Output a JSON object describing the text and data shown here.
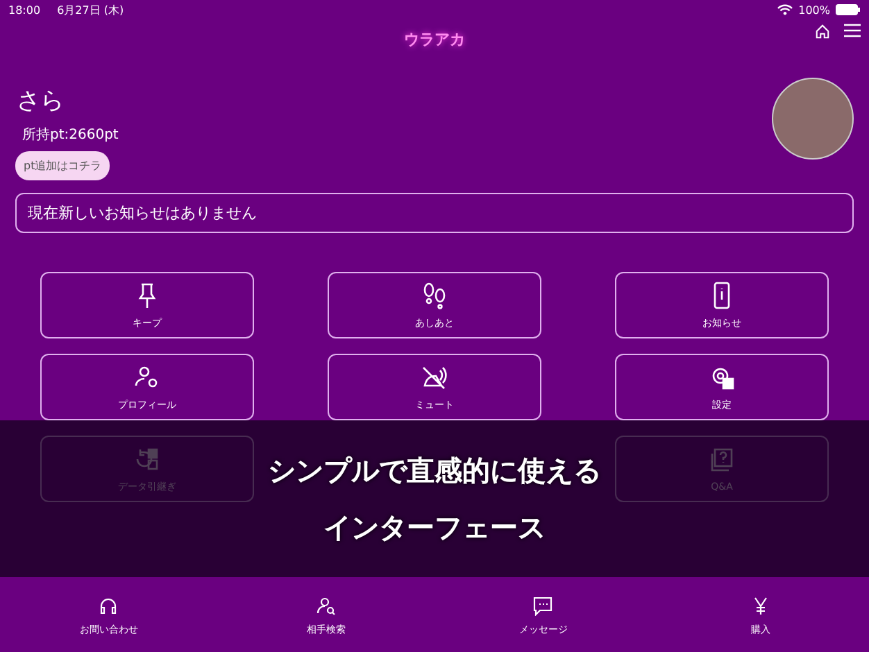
{
  "status_bar": {
    "time": "18:00",
    "date": "6月27日 (木)",
    "battery": "100%"
  },
  "header": {
    "logo": "ウラアカ"
  },
  "profile": {
    "name": "さら",
    "points": "所持pt:2660pt",
    "add_points_button": "pt追加はコチラ"
  },
  "notice": {
    "text": "現在新しいお知らせはありません"
  },
  "menu": [
    {
      "label": "キープ"
    },
    {
      "label": "あしあと"
    },
    {
      "label": "お知らせ"
    },
    {
      "label": "プロフィール"
    },
    {
      "label": "ミュート"
    },
    {
      "label": "設定"
    },
    {
      "label": "データ引継ぎ"
    },
    {
      "label": "Q&A"
    }
  ],
  "overlay_caption": [
    "シンプルで直感的に使える",
    "インターフェース"
  ],
  "bottom_nav": [
    {
      "label": "お問い合わせ"
    },
    {
      "label": "相手検索"
    },
    {
      "label": "メッセージ"
    },
    {
      "label": "購入"
    }
  ]
}
